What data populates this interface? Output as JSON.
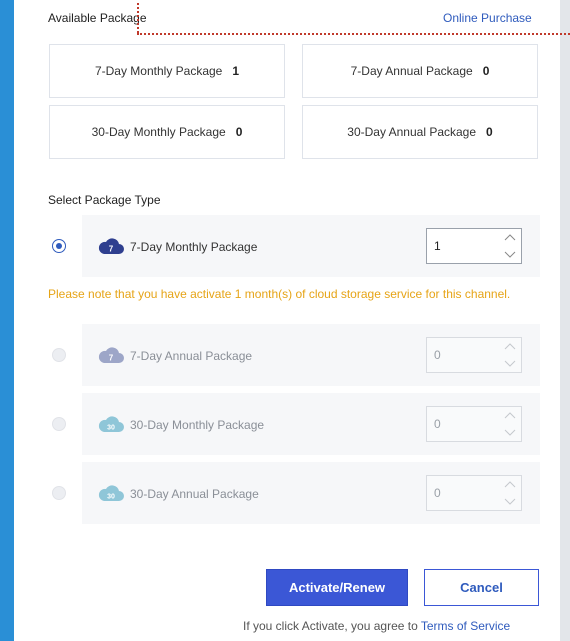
{
  "available": {
    "title": "Available Package",
    "online_purchase": "Online Purchase",
    "packages": [
      {
        "label": "7-Day Monthly Package",
        "count": "1"
      },
      {
        "label": "7-Day Annual Package",
        "count": "0"
      },
      {
        "label": "30-Day Monthly Package",
        "count": "0"
      },
      {
        "label": "30-Day Annual Package",
        "count": "0"
      }
    ]
  },
  "select": {
    "title": "Select Package Type",
    "options": [
      {
        "label": "7-Day Monthly Package",
        "value": "1",
        "icon_text": "7",
        "icon_color": "#2f3f8f",
        "selected": true,
        "disabled": false
      },
      {
        "label": "7-Day Annual Package",
        "value": "0",
        "icon_text": "7",
        "icon_color": "#9da6c8",
        "selected": false,
        "disabled": true
      },
      {
        "label": "30-Day Monthly Package",
        "value": "0",
        "icon_text": "30",
        "icon_color": "#8fc6d8",
        "selected": false,
        "disabled": true
      },
      {
        "label": "30-Day Annual Package",
        "value": "0",
        "icon_text": "30",
        "icon_color": "#8fc6d8",
        "selected": false,
        "disabled": true
      }
    ],
    "notice": "Please note that you have activate 1 month(s) of cloud storage service for this channel."
  },
  "actions": {
    "activate": "Activate/Renew",
    "cancel": "Cancel"
  },
  "footer": {
    "text": "If you click Activate, you agree to ",
    "link": "Terms of Service"
  },
  "colors": {
    "accent": "#3b57d6",
    "link": "#2f5bbd",
    "notice": "#e6a417",
    "frame": "#2a8fd6"
  }
}
